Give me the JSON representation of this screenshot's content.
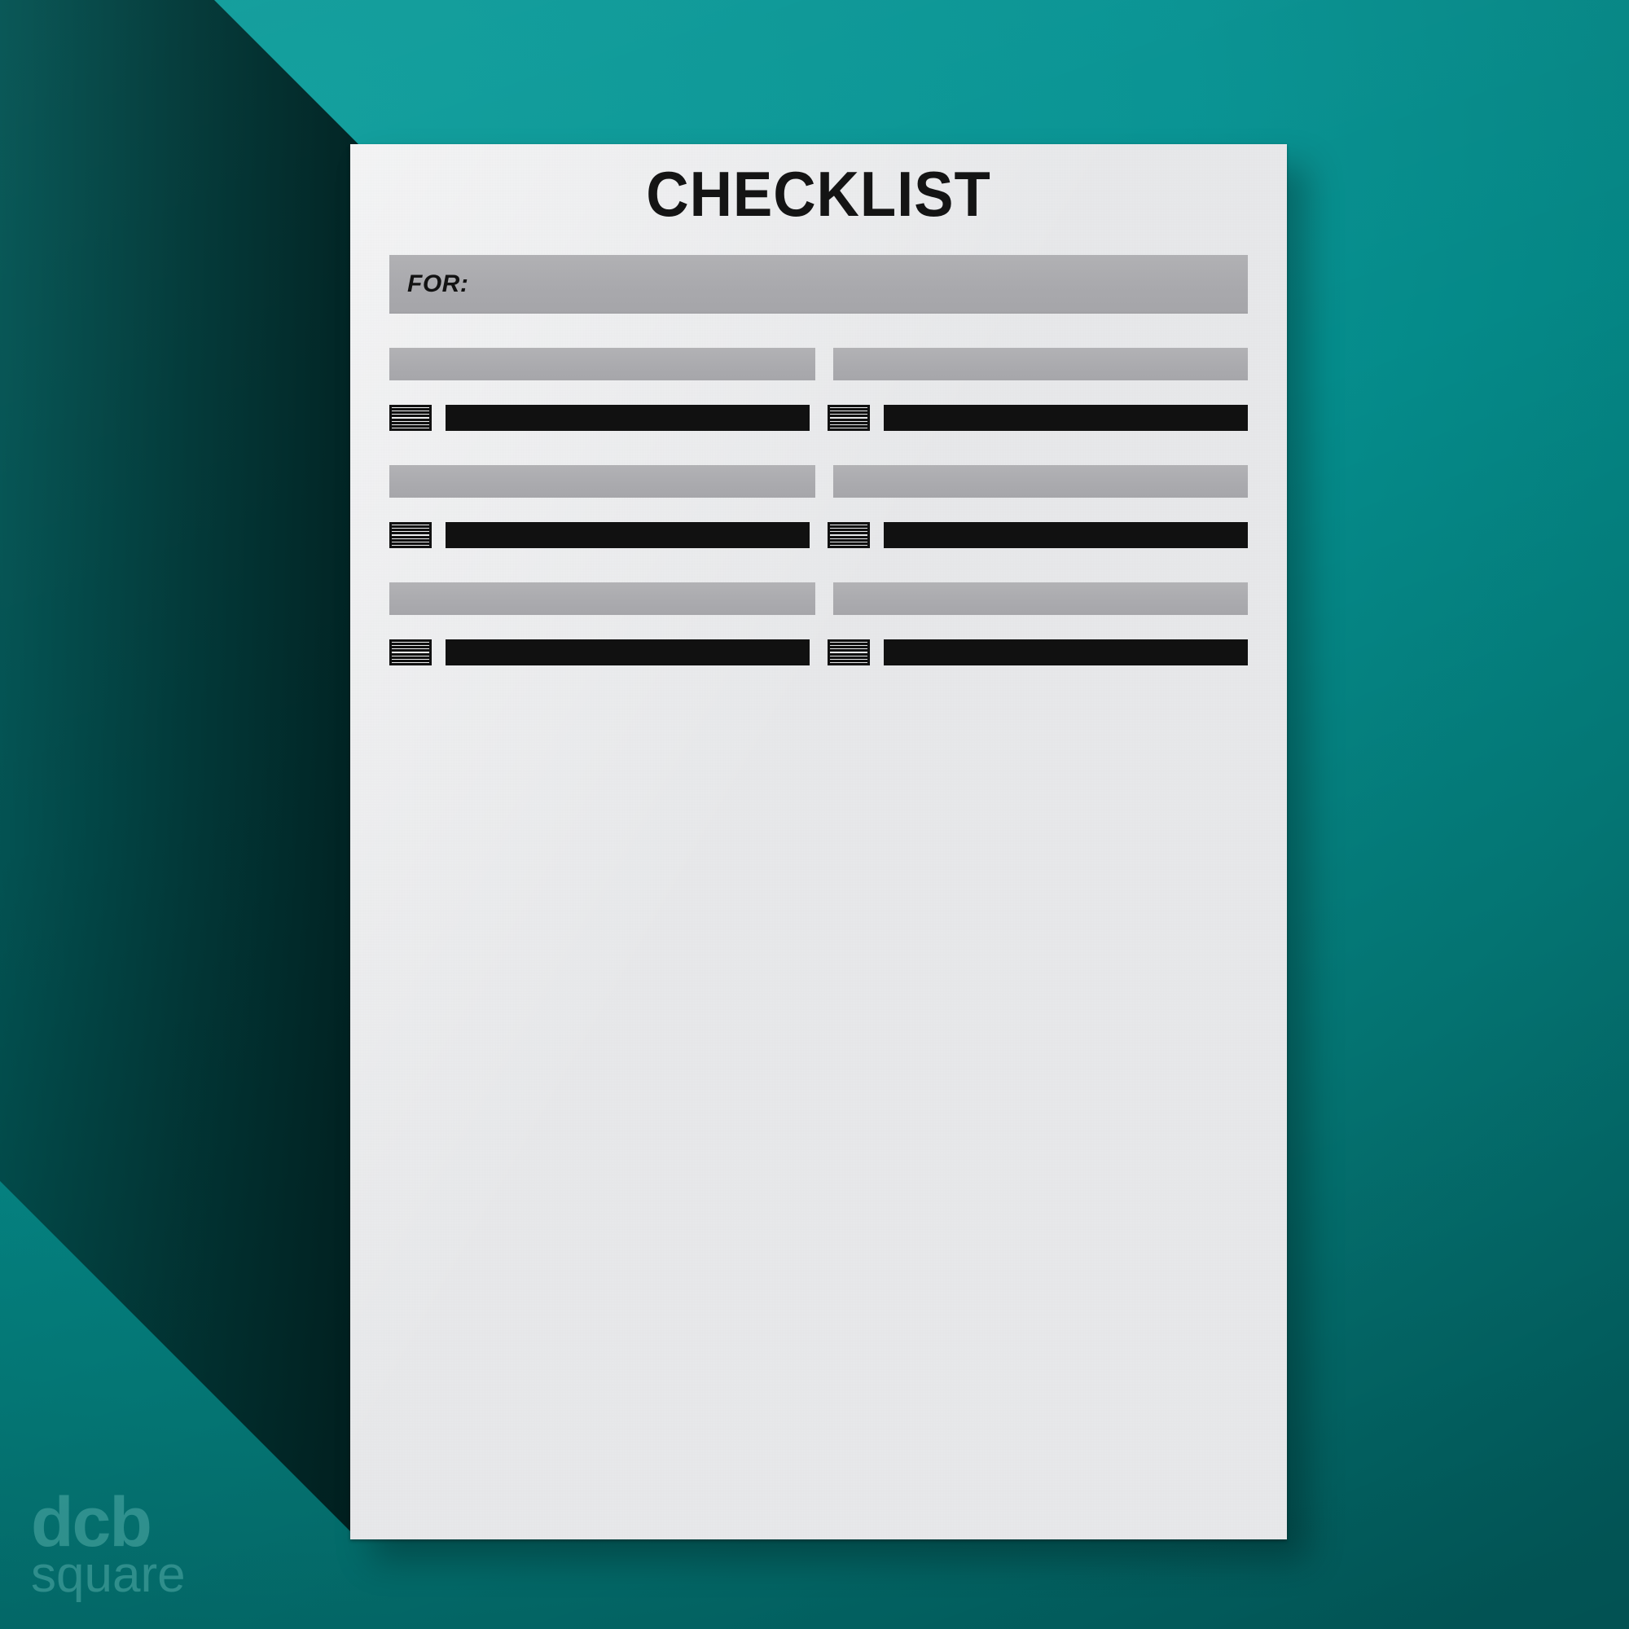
{
  "background": {
    "color": "#068E8E",
    "gradient_from": "#0B9C9A",
    "gradient_to": "#02696A",
    "shadow_color": "#001C1C"
  },
  "sheet": {
    "color": "#E9EAEC",
    "ink_color": "#111111",
    "bar_color": "#ACACAF"
  },
  "document": {
    "title": "CHECKLIST",
    "for_label": "FOR:"
  },
  "sections": [
    {
      "id": "section-1",
      "header_left": "",
      "header_right": "",
      "columns": [
        {
          "id": "section-1-col-left",
          "checkbox_count": 7,
          "line_count": 8,
          "items": [
            "",
            "",
            "",
            "",
            "",
            "",
            "",
            ""
          ]
        },
        {
          "id": "section-1-col-right",
          "checkbox_count": 7,
          "line_count": 8,
          "items": [
            "",
            "",
            "",
            "",
            "",
            "",
            "",
            ""
          ]
        }
      ]
    },
    {
      "id": "section-2",
      "header_left": "",
      "header_right": "",
      "columns": [
        {
          "id": "section-2-col-left",
          "checkbox_count": 7,
          "line_count": 8,
          "items": [
            "",
            "",
            "",
            "",
            "",
            "",
            "",
            ""
          ]
        },
        {
          "id": "section-2-col-right",
          "checkbox_count": 7,
          "line_count": 8,
          "items": [
            "",
            "",
            "",
            "",
            "",
            "",
            "",
            ""
          ]
        }
      ]
    },
    {
      "id": "section-3",
      "header_left": "",
      "header_right": "",
      "columns": [
        {
          "id": "section-3-col-left",
          "checkbox_count": 7,
          "line_count": 8,
          "items": [
            "",
            "",
            "",
            "",
            "",
            "",
            "",
            ""
          ]
        },
        {
          "id": "section-3-col-right",
          "checkbox_count": 7,
          "line_count": 8,
          "items": [
            "",
            "",
            "",
            "",
            "",
            "",
            "",
            ""
          ]
        }
      ]
    }
  ],
  "watermark": {
    "line1": "dcb",
    "line2": "square",
    "color": "#96E0DB"
  }
}
